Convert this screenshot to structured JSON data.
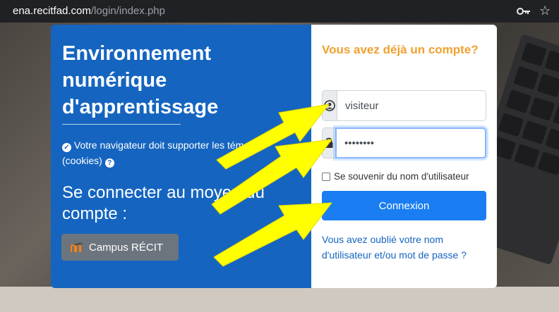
{
  "browser": {
    "url_host": "ena.recitfad.com",
    "url_path": "/login/index.php",
    "icons": [
      "key-icon",
      "star-icon"
    ]
  },
  "left_panel": {
    "title": "Environnement numérique d'apprentissage",
    "cookie_notice": "Votre navigateur doit supporter les témoins (cookies)",
    "connect_heading": "Se connecter au moyen du compte :",
    "campus_button": "Campus RÉCIT",
    "background_color": "#1565c0"
  },
  "login_form": {
    "question": "Vous avez déjà un compte?",
    "username_value": "visiteur",
    "password_value": "••••••••",
    "remember_label": "Se souvenir du nom d'utilisateur",
    "login_button": "Connexion",
    "forgot_link": "Vous avez oublié votre nom d'utilisateur et/ou mot de passe ?",
    "accent_color": "#f0a030",
    "button_color": "#1a7ef2"
  },
  "annotations": {
    "arrow_color": "#ffff00",
    "arrow_count": 3
  }
}
